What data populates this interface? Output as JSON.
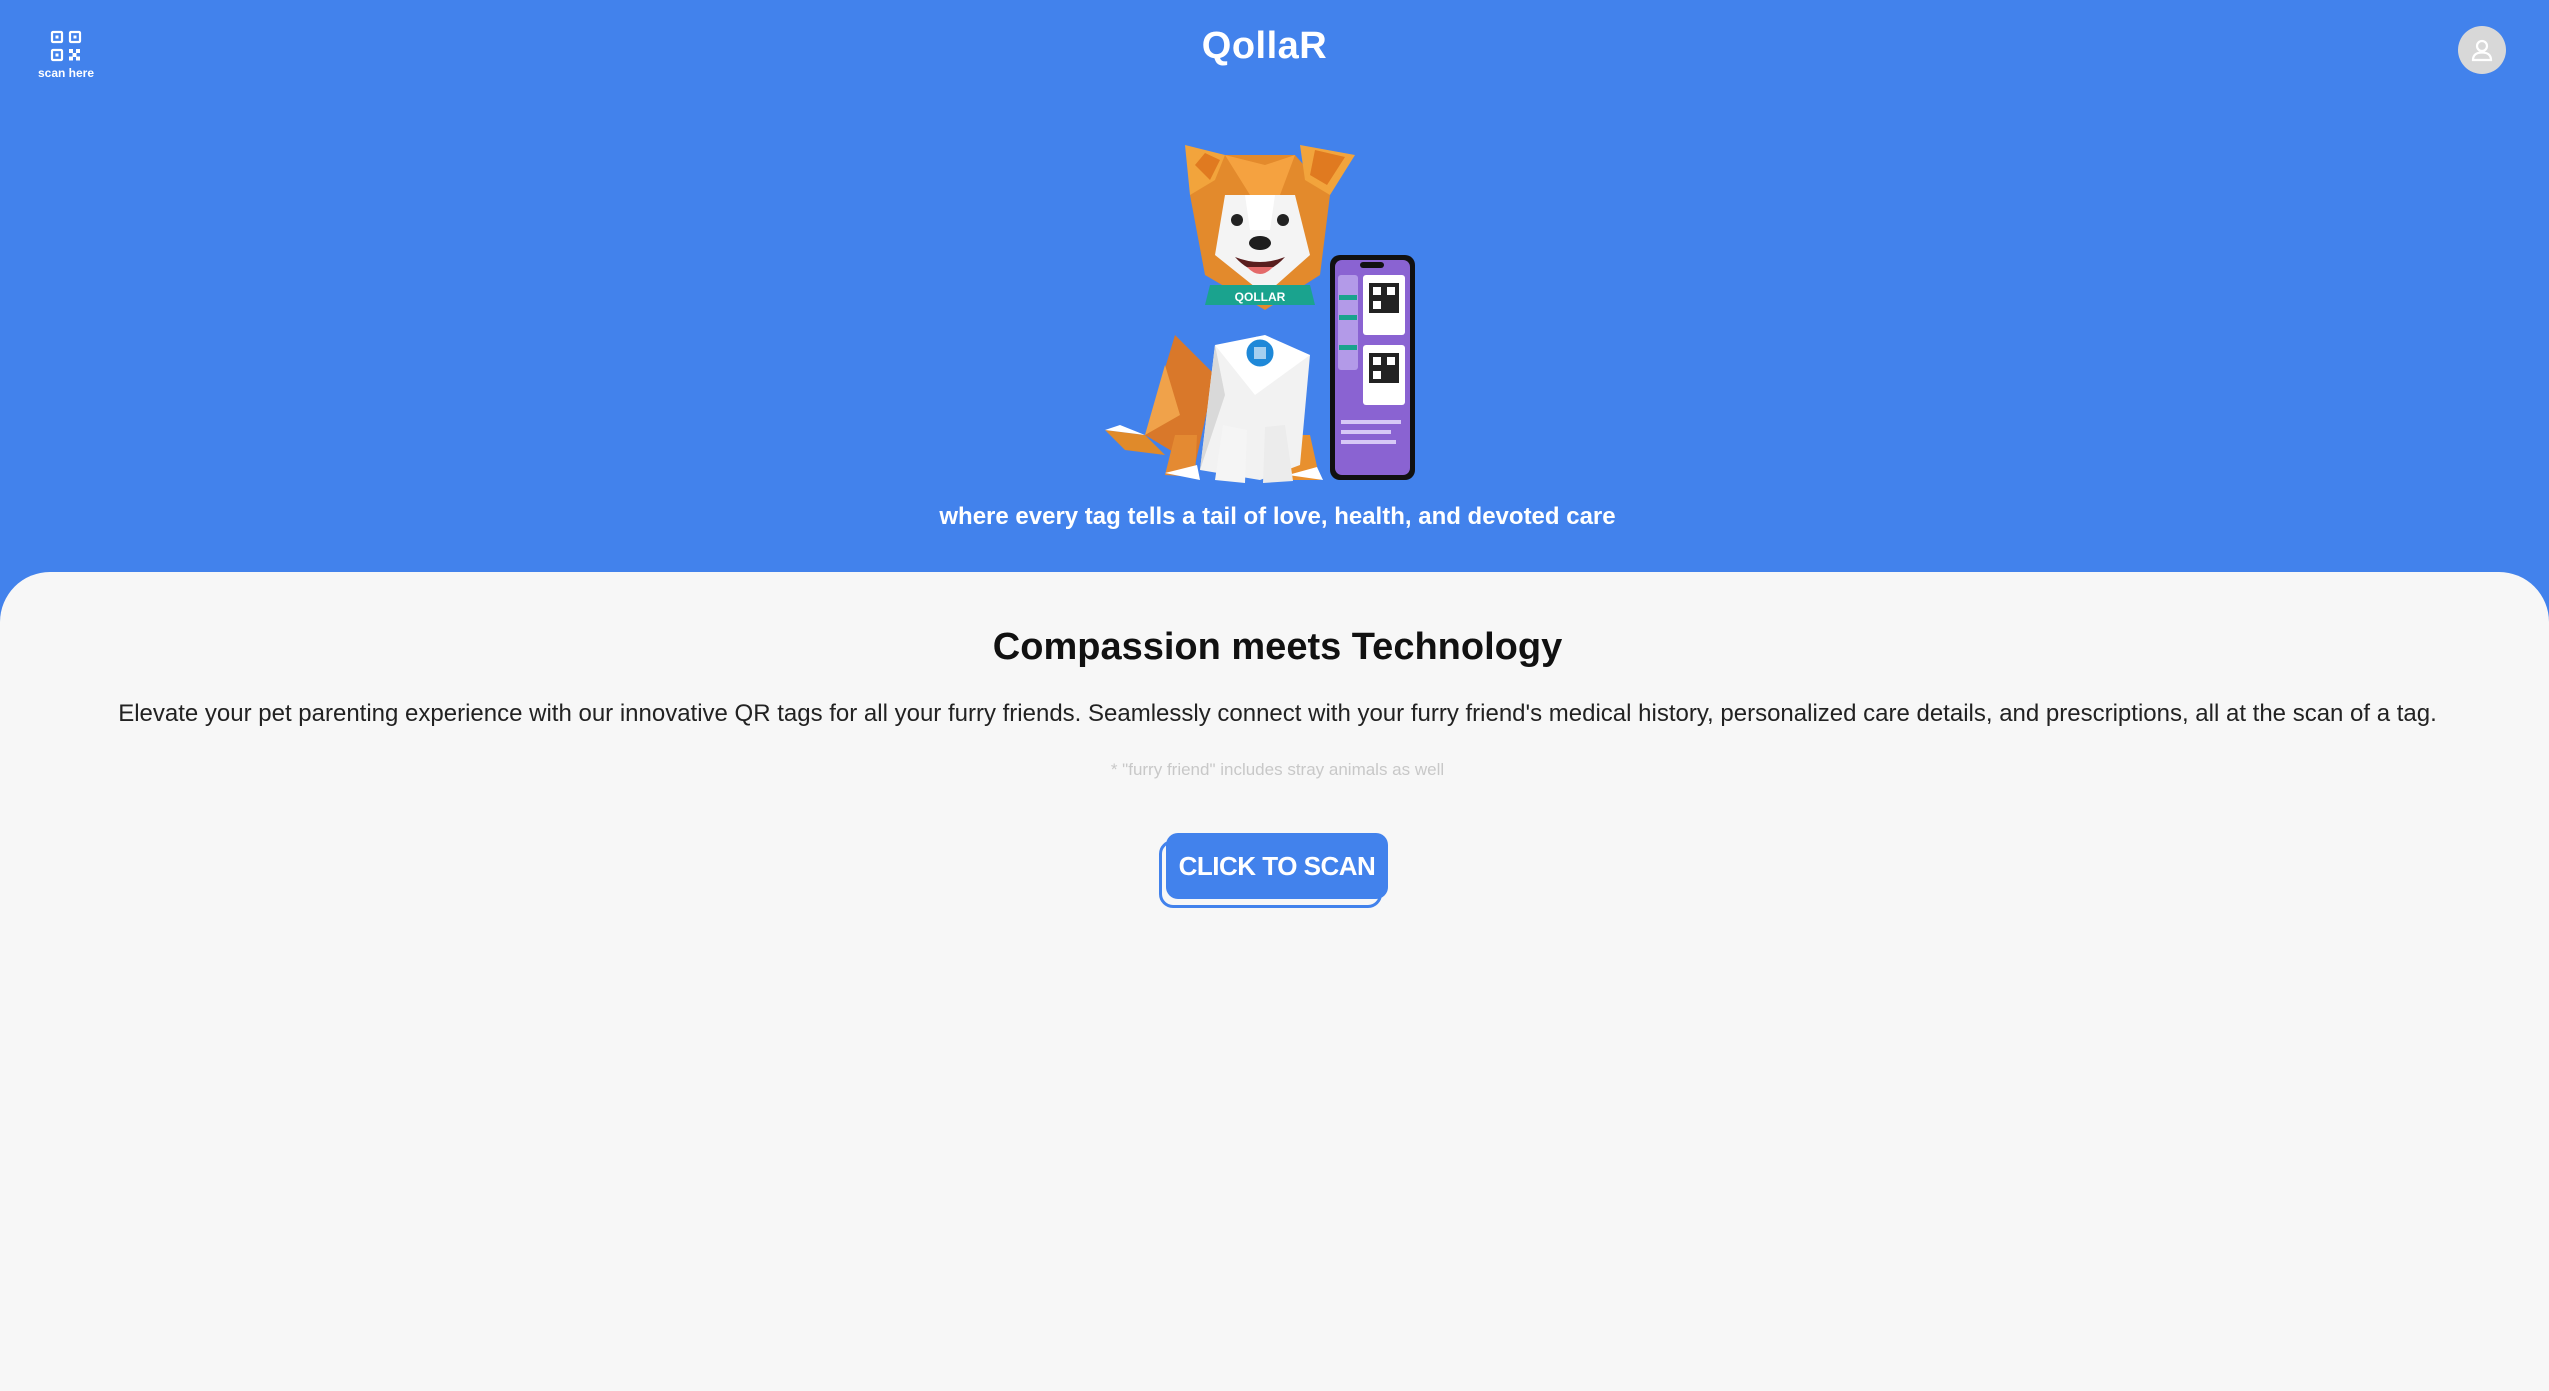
{
  "header": {
    "scan_label": "scan here",
    "brand": "QollaR",
    "avatar_icon": "user-icon",
    "scan_icon": "qr-code-icon"
  },
  "hero": {
    "tagline": "where every tag tells a tail of love, health, and devoted care",
    "illustration": {
      "collar_text": "QOLLAR"
    }
  },
  "main": {
    "heading": "Compassion meets Technology",
    "description": "Elevate your pet parenting experience with our innovative QR tags for all your furry friends. Seamlessly connect with your furry friend's medical history, personalized care details, and prescriptions, all at the scan of a tag.",
    "footnote": "* \"furry friend\" includes stray animals as well",
    "cta_label": "CLICK TO SCAN"
  },
  "colors": {
    "primary": "#4282ec",
    "background": "#f7f7f7",
    "text": "#111111"
  }
}
